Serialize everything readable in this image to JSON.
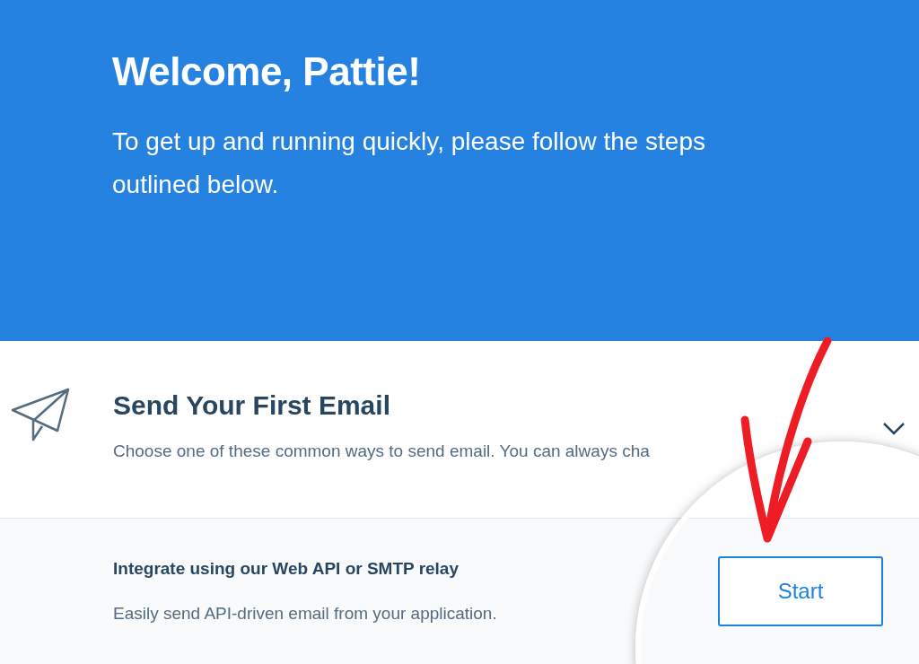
{
  "hero": {
    "title": "Welcome, Pattie!",
    "subtitle": "To get up and running quickly, please follow the steps outlined below."
  },
  "step": {
    "title": "Send Your First Email",
    "description": "Choose one of these common ways to send email. You can always cha"
  },
  "options": [
    {
      "title": "Integrate using our Web API or SMTP relay",
      "description": "Easily send API-driven email from your application.",
      "button": "Start"
    }
  ]
}
